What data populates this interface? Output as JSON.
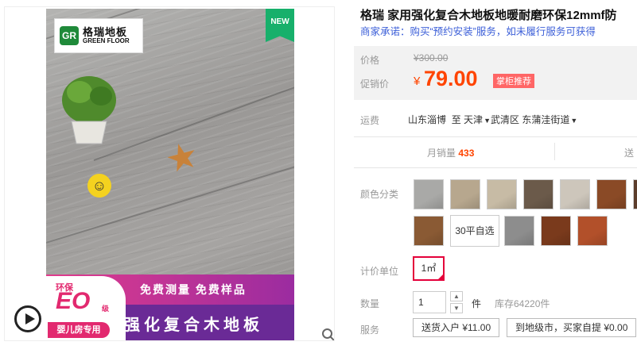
{
  "gallery": {
    "logo_cn": "格瑞地板",
    "logo_en": "GREEN FLOOR",
    "new_badge": "NEW",
    "eco_label": "环保",
    "eco_grade": "EO",
    "eco_level": "级",
    "eco_baby": "婴儿房专用",
    "banner_free": "免费测量  免费样品",
    "banner_main": "强化复合木地板"
  },
  "product": {
    "title": "格瑞 家用强化复合木地板地暖耐磨环保12mmf防",
    "promise": "商家承诺：购买“预约安装”服务，如未履行服务可获得"
  },
  "price": {
    "label_price": "价格",
    "original": "¥300.00",
    "label_promo": "促销价",
    "currency": "¥",
    "promo": "79.00",
    "promo_tag": "掌柜推荐"
  },
  "shipping": {
    "label": "运费",
    "from": "山东淄博",
    "to_prefix": "至",
    "city": "天津",
    "district": "武清区",
    "street": "东蒲洼街道"
  },
  "stats": {
    "sales_label": "月销量",
    "sales_value": "433",
    "more": "送"
  },
  "options": {
    "color_label": "颜色分类",
    "custom_option": "30平自选",
    "swatch_colors": [
      "#a9a9a7",
      "#b7a78e",
      "#c7bba5",
      "#6b5a4a",
      "#cdc6bb",
      "#8a4a26",
      "#5c3d2b",
      "#8a5a34",
      "#8d8d8d",
      "#7a3a1c",
      "#b2502a"
    ],
    "unit_label": "计价单位",
    "unit_value": "1㎡"
  },
  "quantity": {
    "label": "数量",
    "value": "1",
    "unit": "件",
    "stock": "库存64220件"
  },
  "services": {
    "label": "服务",
    "items": [
      "送货入户 ¥11.00",
      "到地级市，买家自提 ¥0.00"
    ]
  }
}
